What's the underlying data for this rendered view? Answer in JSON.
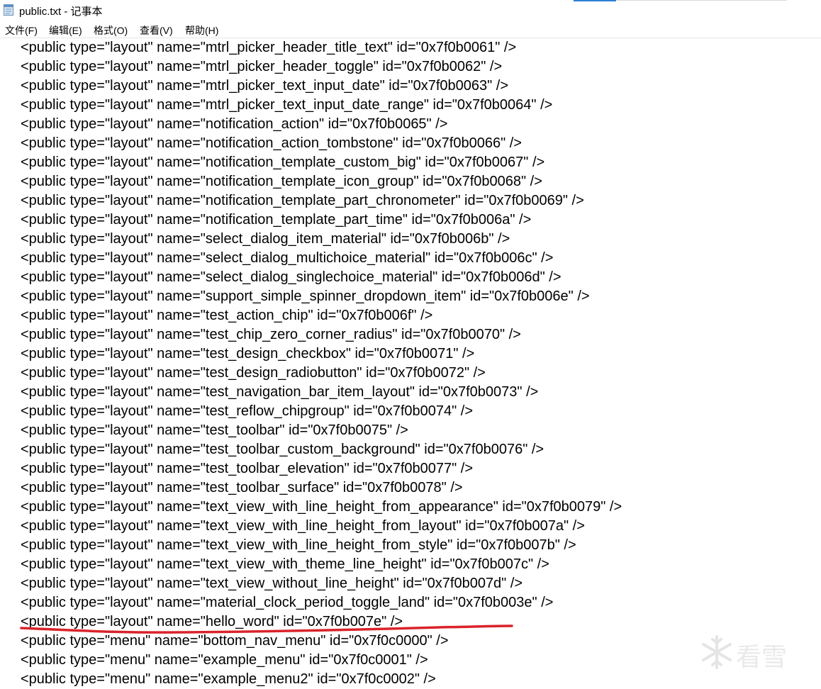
{
  "window": {
    "title": "public.txt - 记事本",
    "icon": "notepad-icon"
  },
  "menu": [
    {
      "label": "文件(F)"
    },
    {
      "label": "编辑(E)"
    },
    {
      "label": "格式(O)"
    },
    {
      "label": "查看(V)"
    },
    {
      "label": "帮助(H)"
    }
  ],
  "lines": [
    "<public type=\"layout\" name=\"mtrl_picker_header_title_text\" id=\"0x7f0b0061\" />",
    "<public type=\"layout\" name=\"mtrl_picker_header_toggle\" id=\"0x7f0b0062\" />",
    "<public type=\"layout\" name=\"mtrl_picker_text_input_date\" id=\"0x7f0b0063\" />",
    "<public type=\"layout\" name=\"mtrl_picker_text_input_date_range\" id=\"0x7f0b0064\" />",
    "<public type=\"layout\" name=\"notification_action\" id=\"0x7f0b0065\" />",
    "<public type=\"layout\" name=\"notification_action_tombstone\" id=\"0x7f0b0066\" />",
    "<public type=\"layout\" name=\"notification_template_custom_big\" id=\"0x7f0b0067\" />",
    "<public type=\"layout\" name=\"notification_template_icon_group\" id=\"0x7f0b0068\" />",
    "<public type=\"layout\" name=\"notification_template_part_chronometer\" id=\"0x7f0b0069\" />",
    "<public type=\"layout\" name=\"notification_template_part_time\" id=\"0x7f0b006a\" />",
    "<public type=\"layout\" name=\"select_dialog_item_material\" id=\"0x7f0b006b\" />",
    "<public type=\"layout\" name=\"select_dialog_multichoice_material\" id=\"0x7f0b006c\" />",
    "<public type=\"layout\" name=\"select_dialog_singlechoice_material\" id=\"0x7f0b006d\" />",
    "<public type=\"layout\" name=\"support_simple_spinner_dropdown_item\" id=\"0x7f0b006e\" />",
    "<public type=\"layout\" name=\"test_action_chip\" id=\"0x7f0b006f\" />",
    "<public type=\"layout\" name=\"test_chip_zero_corner_radius\" id=\"0x7f0b0070\" />",
    "<public type=\"layout\" name=\"test_design_checkbox\" id=\"0x7f0b0071\" />",
    "<public type=\"layout\" name=\"test_design_radiobutton\" id=\"0x7f0b0072\" />",
    "<public type=\"layout\" name=\"test_navigation_bar_item_layout\" id=\"0x7f0b0073\" />",
    "<public type=\"layout\" name=\"test_reflow_chipgroup\" id=\"0x7f0b0074\" />",
    "<public type=\"layout\" name=\"test_toolbar\" id=\"0x7f0b0075\" />",
    "<public type=\"layout\" name=\"test_toolbar_custom_background\" id=\"0x7f0b0076\" />",
    "<public type=\"layout\" name=\"test_toolbar_elevation\" id=\"0x7f0b0077\" />",
    "<public type=\"layout\" name=\"test_toolbar_surface\" id=\"0x7f0b0078\" />",
    "<public type=\"layout\" name=\"text_view_with_line_height_from_appearance\" id=\"0x7f0b0079\" />",
    "<public type=\"layout\" name=\"text_view_with_line_height_from_layout\" id=\"0x7f0b007a\" />",
    "<public type=\"layout\" name=\"text_view_with_line_height_from_style\" id=\"0x7f0b007b\" />",
    "<public type=\"layout\" name=\"text_view_with_theme_line_height\" id=\"0x7f0b007c\" />",
    "<public type=\"layout\" name=\"text_view_without_line_height\" id=\"0x7f0b007d\" />",
    "<public type=\"layout\" name=\"material_clock_period_toggle_land\" id=\"0x7f0b003e\" />",
    "<public type=\"layout\" name=\"hello_word\" id=\"0x7f0b007e\" />",
    "<public type=\"menu\" name=\"bottom_nav_menu\" id=\"0x7f0c0000\" />",
    "<public type=\"menu\" name=\"example_menu\" id=\"0x7f0c0001\" />",
    "<public type=\"menu\" name=\"example_menu2\" id=\"0x7f0c0002\" />"
  ],
  "annotation": {
    "highlighted_line": 31,
    "color": "#d9232a"
  },
  "watermark": {
    "icon": "snowflake-icon",
    "text": "看雪"
  },
  "colors": {
    "text": "#000000",
    "background": "#ffffff",
    "underline": "#d9232a"
  }
}
